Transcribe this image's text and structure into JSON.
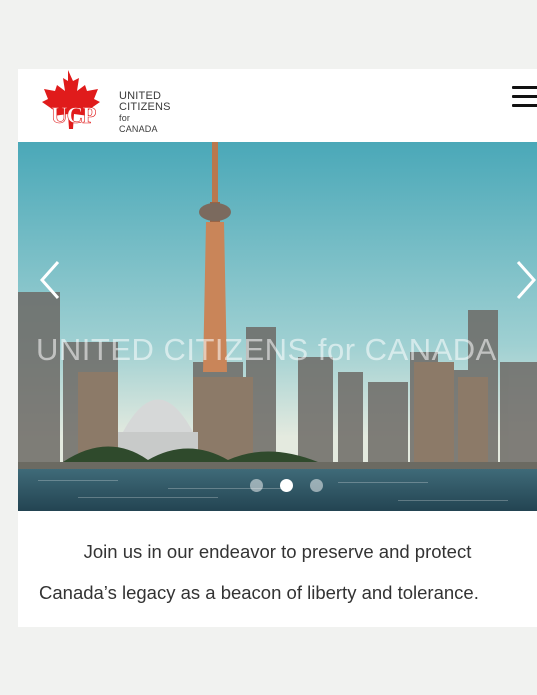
{
  "logo": {
    "line1": "UNITED",
    "line2": "CITIZENS",
    "line3": "for CANADA",
    "icon": "maple-leaf-icon",
    "color": "#e01b1b"
  },
  "header": {
    "menu_icon": "hamburger-menu-icon"
  },
  "carousel": {
    "caption": "UNITED CITIZENS for CANADA",
    "prev_icon": "chevron-left-icon",
    "next_icon": "chevron-right-icon",
    "slide_count": 3,
    "active_slide": 2
  },
  "tagline": {
    "line1": "Join us in our endeavor to preserve and protect",
    "line2": "Canada’s legacy as a beacon of liberty and tolerance."
  },
  "colors": {
    "page_background": "#f1f2f0",
    "card_background": "#ffffff",
    "brand_red": "#e01b1b"
  }
}
